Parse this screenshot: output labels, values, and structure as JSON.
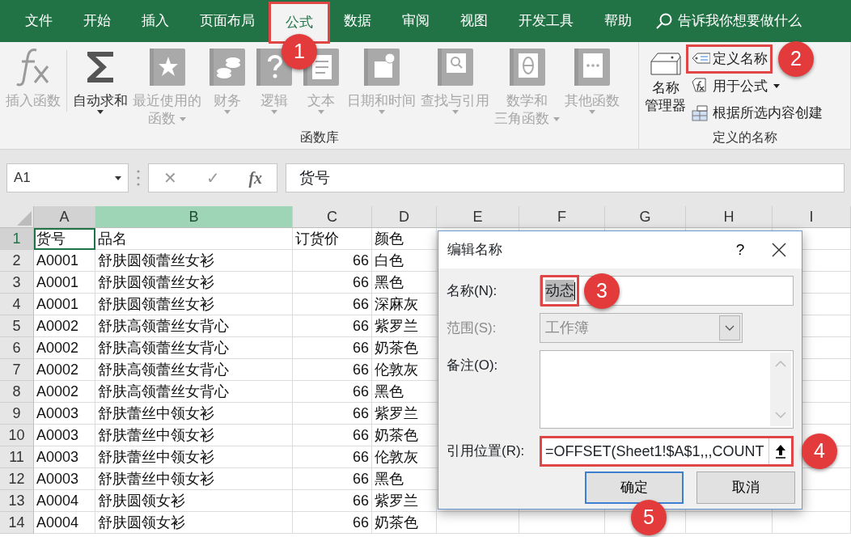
{
  "ribbon_tabs": [
    {
      "label": "文件",
      "selected": false
    },
    {
      "label": "开始",
      "selected": false
    },
    {
      "label": "插入",
      "selected": false
    },
    {
      "label": "页面布局",
      "selected": false
    },
    {
      "label": "公式",
      "selected": true,
      "callout": "1"
    },
    {
      "label": "数据",
      "selected": false
    },
    {
      "label": "审阅",
      "selected": false
    },
    {
      "label": "视图",
      "selected": false
    },
    {
      "label": "开发工具",
      "selected": false
    },
    {
      "label": "帮助",
      "selected": false
    }
  ],
  "tell_me": "告诉我你想要做什么",
  "function_library": {
    "label": "函数库",
    "buttons": [
      {
        "kind": "fx",
        "lines": [
          "插入函数"
        ],
        "disabled": true,
        "dropdown": false
      },
      {
        "kind": "sigma",
        "lines": [
          "自动求和"
        ],
        "disabled": false,
        "dropdown": true
      },
      {
        "kind": "star",
        "lines": [
          "最近使用的",
          "函数"
        ],
        "disabled": true,
        "dropdown": true
      },
      {
        "kind": "coins",
        "lines": [
          "财务"
        ],
        "disabled": true,
        "dropdown": true
      },
      {
        "kind": "question",
        "lines": [
          "逻辑"
        ],
        "disabled": true,
        "dropdown": true
      },
      {
        "kind": "letter",
        "lines": [
          "文本"
        ],
        "disabled": true,
        "dropdown": true
      },
      {
        "kind": "calendar",
        "lines": [
          "日期和时间"
        ],
        "disabled": true,
        "dropdown": true
      },
      {
        "kind": "magnifier",
        "lines": [
          "查找与引用"
        ],
        "disabled": true,
        "dropdown": true
      },
      {
        "kind": "theta",
        "lines": [
          "数学和",
          "三角函数"
        ],
        "disabled": true,
        "dropdown": true
      },
      {
        "kind": "dots",
        "lines": [
          "其他函数"
        ],
        "disabled": true,
        "dropdown": true
      }
    ]
  },
  "defined_names": {
    "label": "定义的名称",
    "manager": [
      "名称",
      "管理器"
    ],
    "buttons": [
      {
        "kind": "tag",
        "label": "定义名称",
        "dropdown": false,
        "callout": "2"
      },
      {
        "kind": "fxtag",
        "label": "用于公式",
        "dropdown": true
      },
      {
        "kind": "table",
        "label": "根据所选内容创建",
        "dropdown": false
      }
    ]
  },
  "formula_bar": {
    "name_box": "A1",
    "cancel": "✕",
    "enter": "✓",
    "fx": "fx",
    "formula": "货号"
  },
  "sheet": {
    "columns": [
      {
        "label": "A",
        "active": true,
        "selected": false
      },
      {
        "label": "B",
        "active": false,
        "selected": true
      },
      {
        "label": "C",
        "active": false,
        "selected": false
      },
      {
        "label": "D",
        "active": false,
        "selected": false
      },
      {
        "label": "E",
        "active": false,
        "selected": false
      },
      {
        "label": "F",
        "active": false,
        "selected": false
      },
      {
        "label": "G",
        "active": false,
        "selected": false
      },
      {
        "label": "H",
        "active": false,
        "selected": false
      },
      {
        "label": "I",
        "active": false,
        "selected": false
      }
    ],
    "rows": [
      {
        "number": "1",
        "selected": true,
        "cells": [
          "货号",
          "品名",
          "订货价",
          "颜色"
        ]
      },
      {
        "number": "2",
        "selected": false,
        "cells": [
          "A0001",
          "舒肤圆领蕾丝女衫",
          "66",
          "白色"
        ]
      },
      {
        "number": "3",
        "selected": false,
        "cells": [
          "A0001",
          "舒肤圆领蕾丝女衫",
          "66",
          "黑色"
        ]
      },
      {
        "number": "4",
        "selected": false,
        "cells": [
          "A0001",
          "舒肤圆领蕾丝女衫",
          "66",
          "深麻灰"
        ]
      },
      {
        "number": "5",
        "selected": false,
        "cells": [
          "A0002",
          "舒肤高领蕾丝女背心",
          "66",
          "紫罗兰"
        ]
      },
      {
        "number": "6",
        "selected": false,
        "cells": [
          "A0002",
          "舒肤高领蕾丝女背心",
          "66",
          "奶茶色"
        ]
      },
      {
        "number": "7",
        "selected": false,
        "cells": [
          "A0002",
          "舒肤高领蕾丝女背心",
          "66",
          "伦敦灰"
        ]
      },
      {
        "number": "8",
        "selected": false,
        "cells": [
          "A0002",
          "舒肤高领蕾丝女背心",
          "66",
          "黑色"
        ]
      },
      {
        "number": "9",
        "selected": false,
        "cells": [
          "A0003",
          "舒肤蕾丝中领女衫",
          "66",
          "紫罗兰"
        ]
      },
      {
        "number": "10",
        "selected": false,
        "cells": [
          "A0003",
          "舒肤蕾丝中领女衫",
          "66",
          "奶茶色"
        ]
      },
      {
        "number": "11",
        "selected": false,
        "cells": [
          "A0003",
          "舒肤蕾丝中领女衫",
          "66",
          "伦敦灰"
        ]
      },
      {
        "number": "12",
        "selected": false,
        "cells": [
          "A0003",
          "舒肤蕾丝中领女衫",
          "66",
          "黑色"
        ]
      },
      {
        "number": "13",
        "selected": false,
        "cells": [
          "A0004",
          "舒肤圆领女衫",
          "66",
          "紫罗兰"
        ]
      },
      {
        "number": "14",
        "selected": false,
        "cells": [
          "A0004",
          "舒肤圆领女衫",
          "66",
          "奶茶色"
        ]
      }
    ]
  },
  "dialog": {
    "title": "编辑名称",
    "help": "?",
    "fields": [
      {
        "kind": "text",
        "label": "名称(N):",
        "value": "动态",
        "disabled": false,
        "callout": "3"
      },
      {
        "kind": "select",
        "label": "范围(S):",
        "value": "工作簿",
        "disabled": true
      },
      {
        "kind": "textarea",
        "label": "备注(O):",
        "disabled": false
      },
      {
        "kind": "reference",
        "label": "引用位置(R):",
        "value": "=OFFSET(Sheet1!$A$1,,,COUNT",
        "disabled": false,
        "callout": "4"
      }
    ],
    "buttons": [
      {
        "label": "确定",
        "default": true,
        "callout": "5"
      },
      {
        "label": "取消",
        "default": false
      }
    ]
  }
}
